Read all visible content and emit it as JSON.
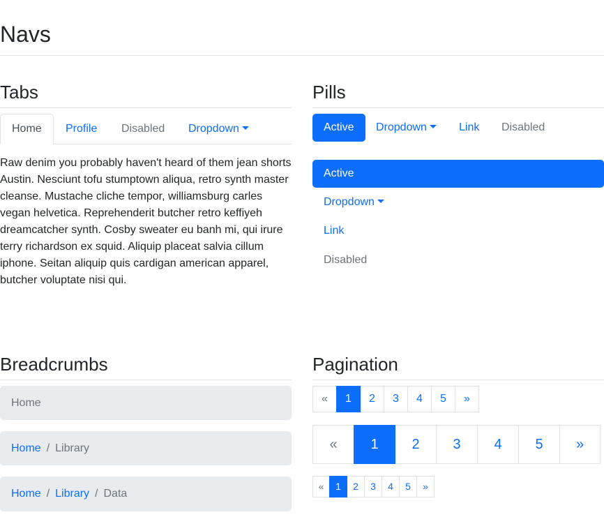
{
  "page": {
    "title": "Navs"
  },
  "tabs": {
    "heading": "Tabs",
    "items": [
      {
        "label": "Home",
        "state": "active"
      },
      {
        "label": "Profile",
        "state": "default"
      },
      {
        "label": "Disabled",
        "state": "disabled"
      },
      {
        "label": "Dropdown",
        "state": "dropdown"
      }
    ],
    "content": "Raw denim you probably haven't heard of them jean shorts Austin. Nesciunt tofu stumptown aliqua, retro synth master cleanse. Mustache cliche tempor, williamsburg carles vegan helvetica. Reprehenderit butcher retro keffiyeh dreamcatcher synth. Cosby sweater eu banh mi, qui irure terry richardson ex squid. Aliquip placeat salvia cillum iphone. Seitan aliquip quis cardigan american apparel, butcher voluptate nisi qui."
  },
  "pills": {
    "heading": "Pills",
    "horizontal": [
      {
        "label": "Active",
        "state": "active"
      },
      {
        "label": "Dropdown",
        "state": "dropdown"
      },
      {
        "label": "Link",
        "state": "default"
      },
      {
        "label": "Disabled",
        "state": "disabled"
      }
    ],
    "vertical": [
      {
        "label": "Active",
        "state": "active"
      },
      {
        "label": "Dropdown",
        "state": "dropdown"
      },
      {
        "label": "Link",
        "state": "default"
      },
      {
        "label": "Disabled",
        "state": "disabled"
      }
    ]
  },
  "breadcrumbs": {
    "heading": "Breadcrumbs",
    "bars": [
      {
        "links": [],
        "current": "Home"
      },
      {
        "links": [
          "Home"
        ],
        "current": "Library"
      },
      {
        "links": [
          "Home",
          "Library"
        ],
        "current": "Data"
      }
    ],
    "separator": "/"
  },
  "pagination": {
    "heading": "Pagination",
    "prev": "«",
    "next": "»",
    "pages": [
      "1",
      "2",
      "3",
      "4",
      "5"
    ],
    "active_page": "1"
  },
  "colors": {
    "primary": "#0d6efd",
    "muted": "#6c757d",
    "border": "#dee2e6",
    "breadcrumb_bg": "#e9ecef"
  }
}
